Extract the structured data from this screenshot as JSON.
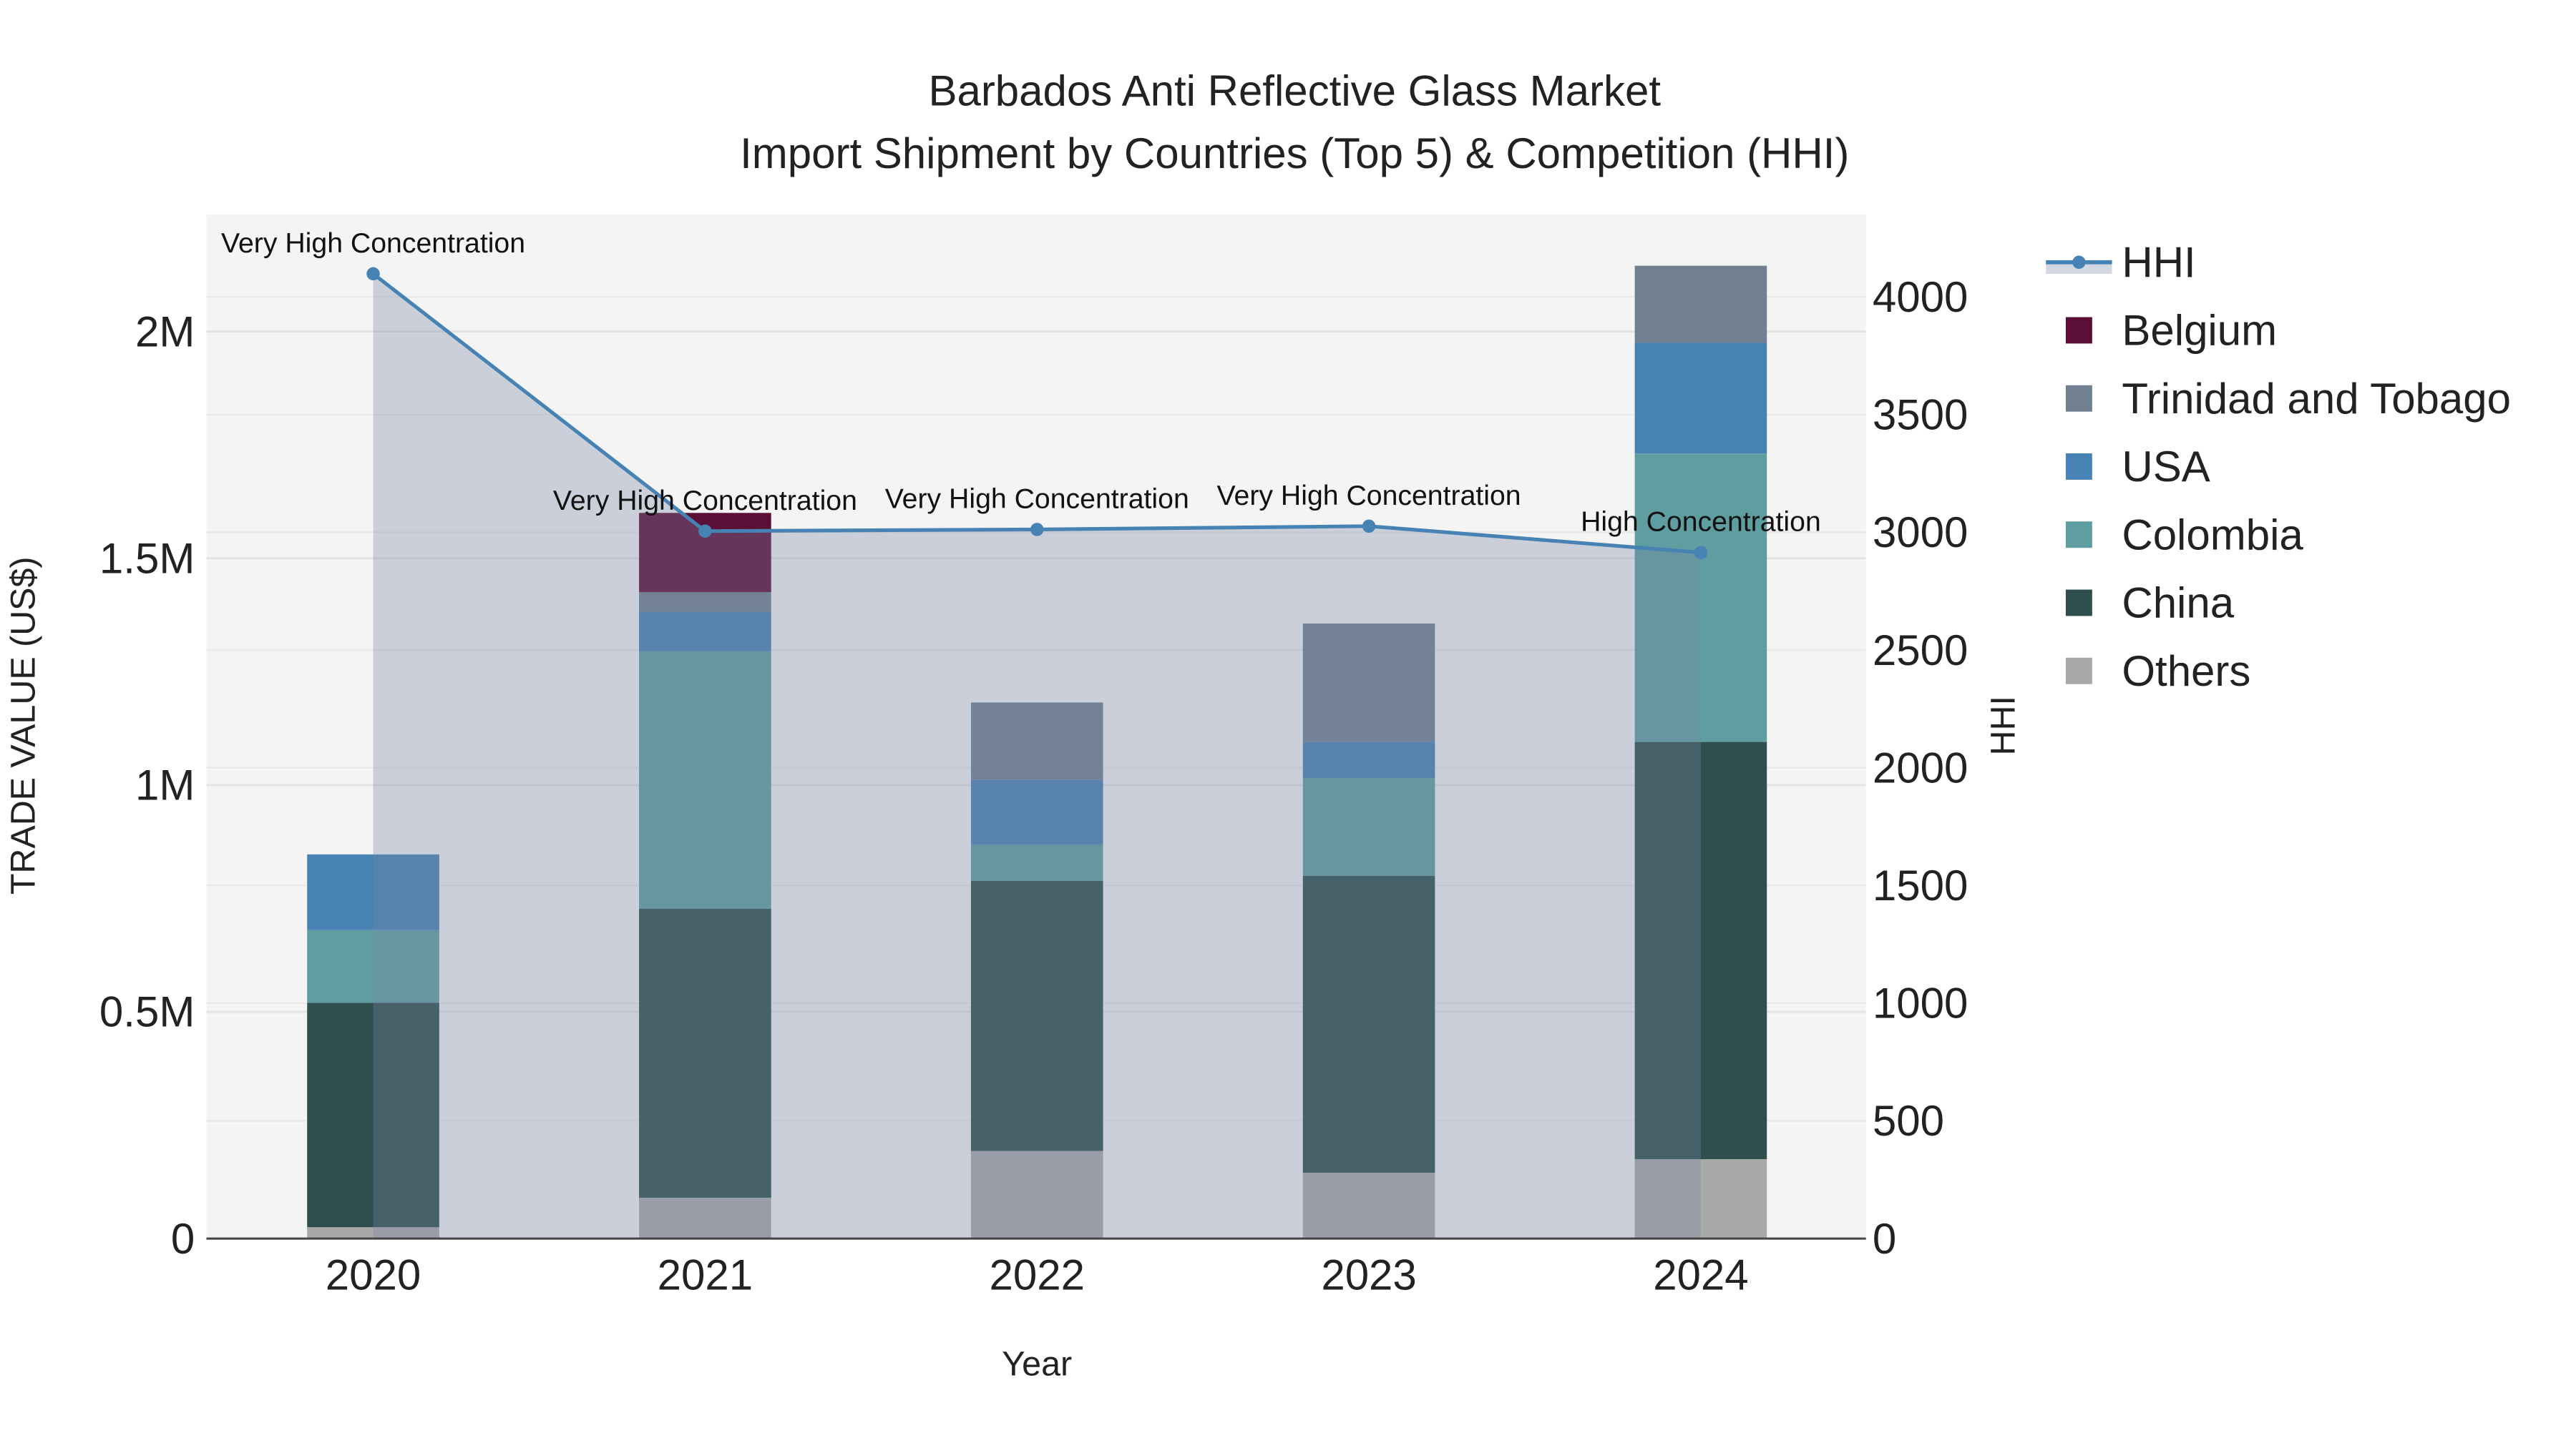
{
  "chart_data": {
    "type": "bar",
    "title": "Barbados Anti Reflective Glass Market",
    "subtitle": "Import Shipment by Countries (Top 5) & Competition (HHI)",
    "xlabel": "Year",
    "ylabel": "TRADE VALUE (US$)",
    "y2label": "HHI",
    "categories": [
      "2020",
      "2021",
      "2022",
      "2023",
      "2024"
    ],
    "ylim": [
      0,
      2250000
    ],
    "y2lim": [
      0,
      4340
    ],
    "yticks": [
      {
        "v": 0,
        "label": "0"
      },
      {
        "v": 500000,
        "label": "0.5M"
      },
      {
        "v": 1000000,
        "label": "1M"
      },
      {
        "v": 1500000,
        "label": "1.5M"
      },
      {
        "v": 2000000,
        "label": "2M"
      }
    ],
    "y2ticks": [
      "0",
      "500",
      "1000",
      "1500",
      "2000",
      "2500",
      "3000",
      "3500",
      "4000"
    ],
    "stacked": true,
    "series": [
      {
        "name": "Others",
        "color": "#a9a9a9",
        "values": [
          25000,
          90000,
          193000,
          145000,
          175000
        ]
      },
      {
        "name": "China",
        "color": "#2f4f4f",
        "values": [
          495000,
          637000,
          596000,
          655000,
          920000
        ]
      },
      {
        "name": "Colombia",
        "color": "#5f9ea0",
        "values": [
          160000,
          568000,
          80000,
          215000,
          636000
        ]
      },
      {
        "name": "USA",
        "color": "#4682b4",
        "values": [
          167000,
          87000,
          142000,
          80000,
          244000
        ]
      },
      {
        "name": "Trinidad and Tobago",
        "color": "#708090",
        "values": [
          0,
          43000,
          171000,
          261000,
          170000
        ]
      },
      {
        "name": "Belgium",
        "color": "#5c0f36",
        "values": [
          0,
          175000,
          0,
          0,
          0
        ]
      }
    ],
    "hhi": {
      "name": "HHI",
      "color": "#4682b4",
      "values": [
        4098,
        3005,
        3012,
        3026,
        2914
      ],
      "annotations": [
        "Very High Concentration",
        "Very High Concentration",
        "Very High Concentration",
        "Very High Concentration",
        "High Concentration"
      ]
    },
    "legend": [
      "HHI",
      "Belgium",
      "Trinidad and Tobago",
      "USA",
      "Colombia",
      "China",
      "Others"
    ],
    "legend_position": "right",
    "grid": true
  }
}
